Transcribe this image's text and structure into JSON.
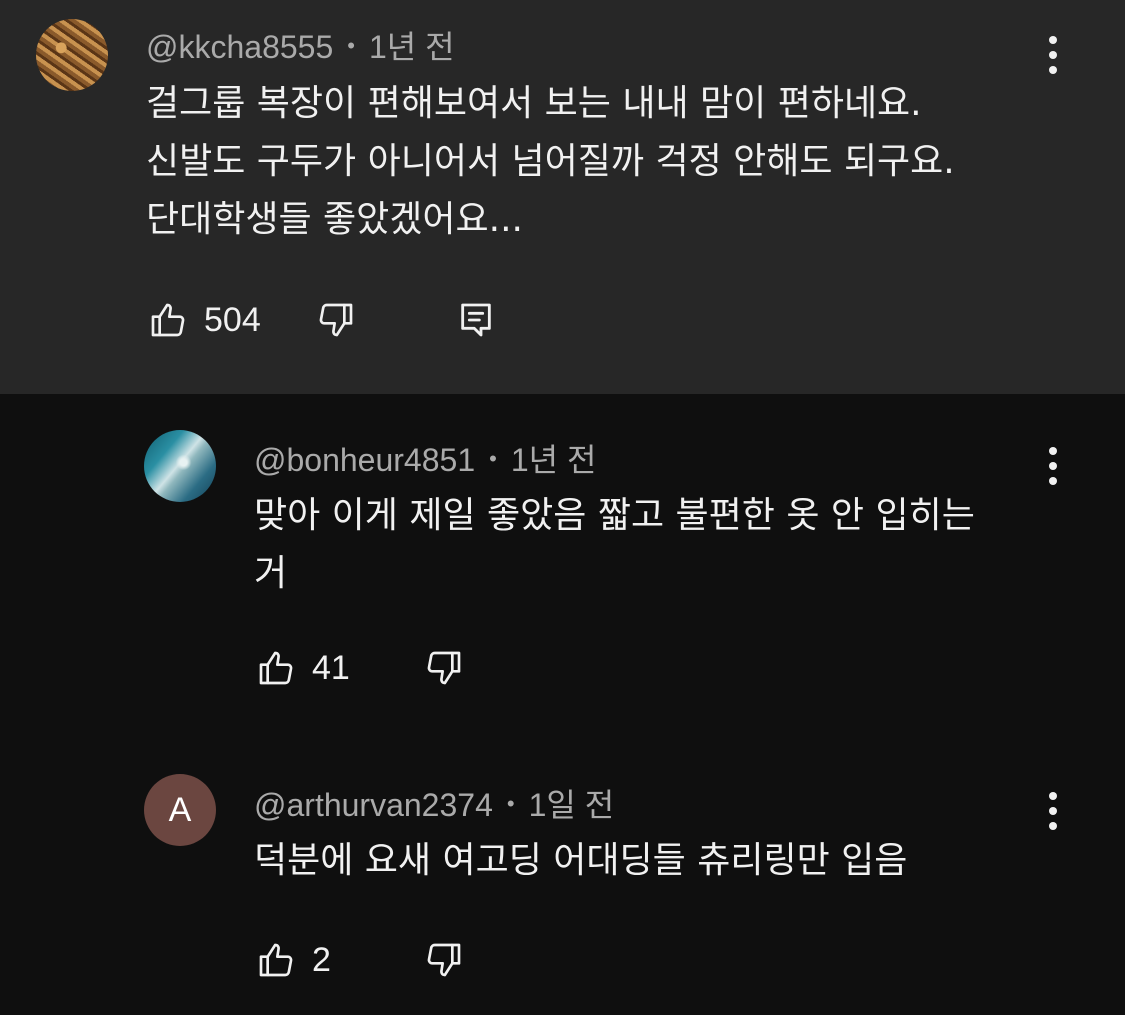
{
  "comments": [
    {
      "author": "@kkcha8555",
      "time": "1년 전",
      "text": "걸그룹 복장이 편해보여서 보는 내내 맘이 편하네요.\n신발도 구두가 아니어서 넘어질까 걱정 안해도 되구요.\n단대학생들 좋았겠어요...",
      "likes": "504",
      "avatar_icon": "profile-photo"
    },
    {
      "author": "@bonheur4851",
      "time": "1년 전",
      "text": "맞아 이게 제일 좋았음 짧고 불편한 옷 안 입히는\n거",
      "likes": "41",
      "avatar_icon": "profile-photo"
    },
    {
      "author": "@arthurvan2374",
      "time": "1일 전",
      "text": "덕분에 요새 여고딩 어대딩들 츄리링만 입음",
      "likes": "2",
      "avatar_letter": "A"
    }
  ],
  "separator": "•",
  "colors": {
    "highlight_bg": "#272727",
    "page_bg": "#0f0f0f",
    "meta_text": "#aaaaaa",
    "avatar_a_bg": "#6b4640"
  },
  "icons": [
    "like-icon",
    "dislike-icon",
    "reply-icon",
    "more-vert-icon"
  ]
}
